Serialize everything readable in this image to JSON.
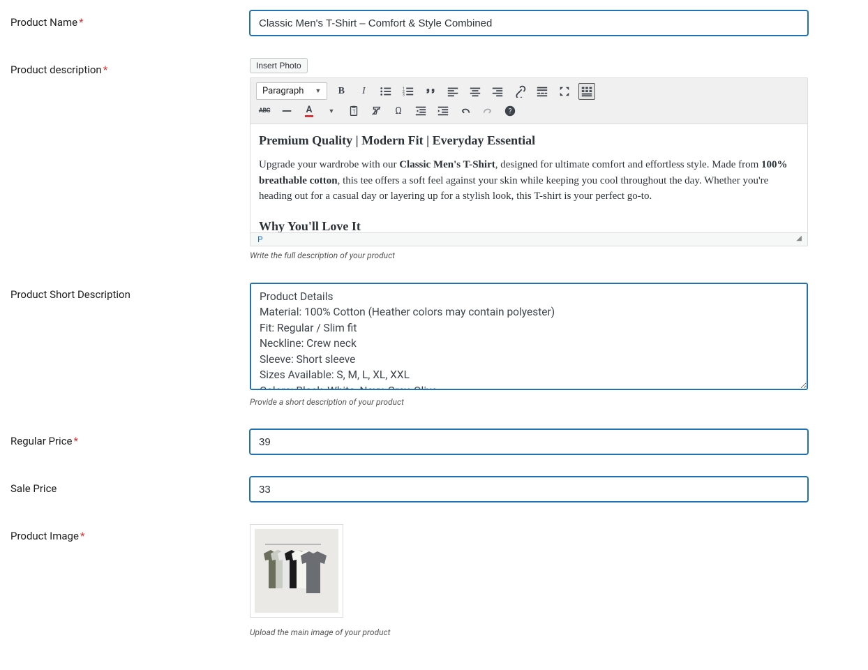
{
  "fields": {
    "product_name": {
      "label": "Product Name",
      "required": "*",
      "value": "Classic Men's T-Shirt – Comfort & Style Combined"
    },
    "product_description": {
      "label": "Product description",
      "required": "*",
      "helper": "Write the full description of your product"
    },
    "short_description": {
      "label": "Product Short Description",
      "helper": "Provide a short description of your product",
      "value": "Product Details\nMaterial: 100% Cotton (Heather colors may contain polyester)\nFit: Regular / Slim fit\nNeckline: Crew neck\nSleeve: Short sleeve\nSizes Available: S, M, L, XL, XXL\nColors: Black, White, Navy, Grey, Olive"
    },
    "regular_price": {
      "label": "Regular Price",
      "required": "*",
      "value": "39"
    },
    "sale_price": {
      "label": "Sale Price",
      "value": "33"
    },
    "product_image": {
      "label": "Product Image",
      "required": "*",
      "helper": "Upload the main image of your product"
    }
  },
  "editor": {
    "insert_photo_label": "Insert Photo",
    "format_select": "Paragraph",
    "status_path": "P",
    "content": {
      "h1": "Premium Quality | Modern Fit | Everyday Essential",
      "p1_a": "Upgrade your wardrobe with our ",
      "p1_b_strong": "Classic Men's T-Shirt",
      "p1_c": ", designed for ultimate comfort and effortless style. Made from ",
      "p1_d_strong": "100% breathable cotton",
      "p1_e": ", this tee offers a soft feel against your skin while keeping you cool throughout the day. Whether you're heading out for a casual day or layering up for a stylish look, this T-shirt is your perfect go-to.",
      "h2": "Why You'll Love It"
    }
  }
}
